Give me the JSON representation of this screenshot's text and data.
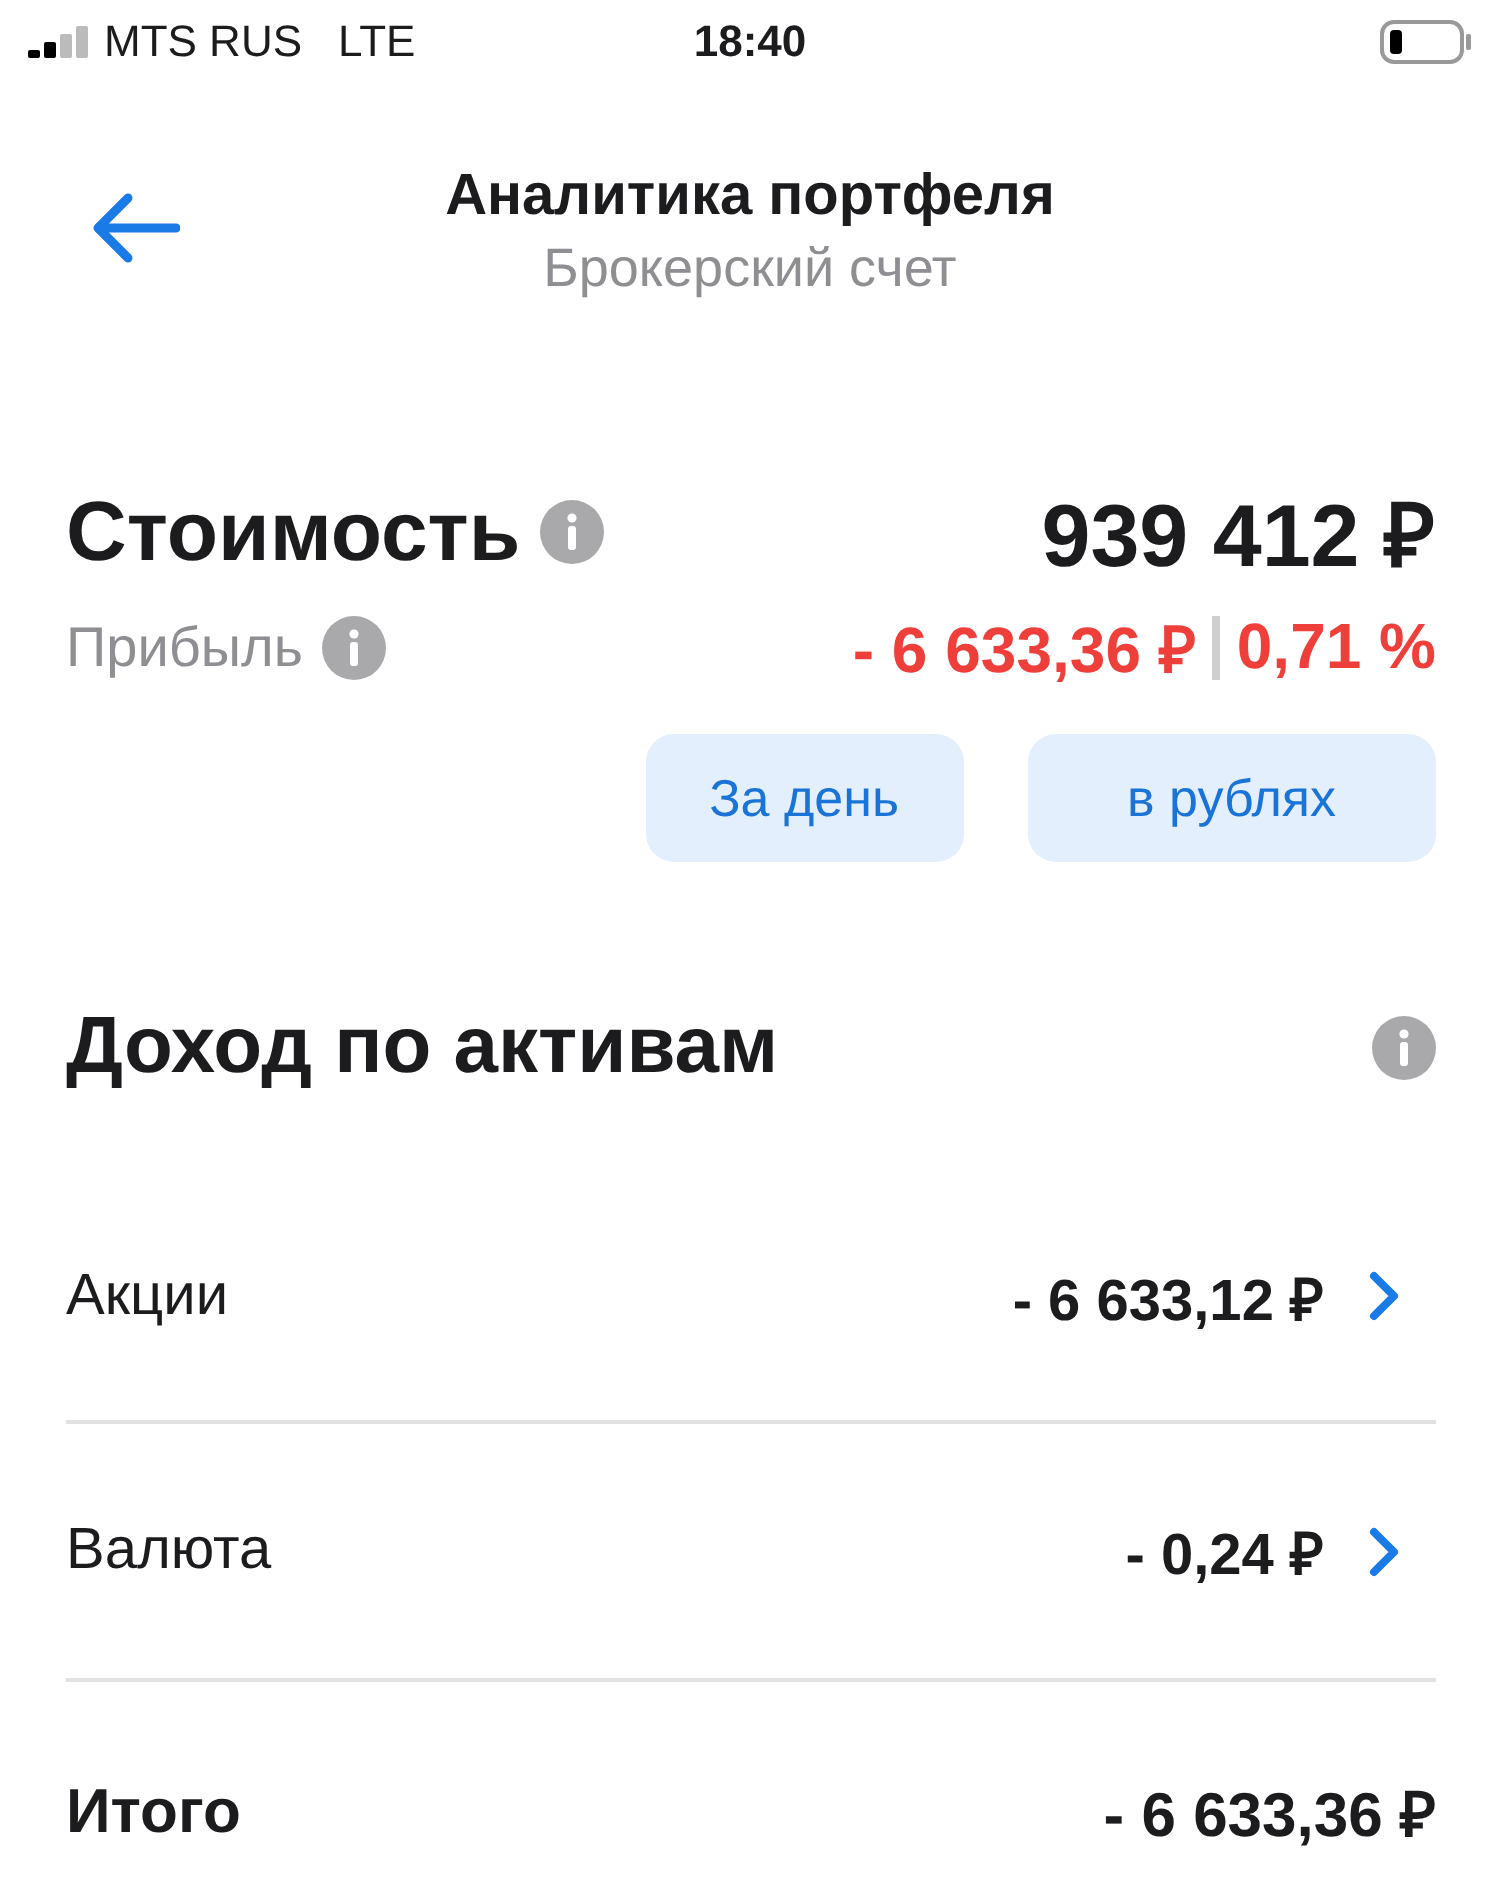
{
  "status_bar": {
    "carrier": "MTS RUS",
    "network": "LTE",
    "time": "18:40"
  },
  "header": {
    "title": "Аналитика портфеля",
    "subtitle": "Брокерский счет"
  },
  "summary": {
    "value_label": "Стоимость",
    "value": "939 412 ₽",
    "profit_label": "Прибыль",
    "profit": "- 6 633,36 ₽",
    "profit_percent": "0,71 %"
  },
  "filters": [
    "За день",
    "в рублях"
  ],
  "section": {
    "title": "Доход по активам"
  },
  "rows": [
    {
      "kind": "asset",
      "label": "Акции",
      "value": "- 6 633,12 ₽"
    },
    {
      "kind": "asset",
      "label": "Валюта",
      "value": "- 0,24 ₽"
    },
    {
      "kind": "total",
      "label": "Итого",
      "value": "- 6 633,36 ₽"
    }
  ]
}
